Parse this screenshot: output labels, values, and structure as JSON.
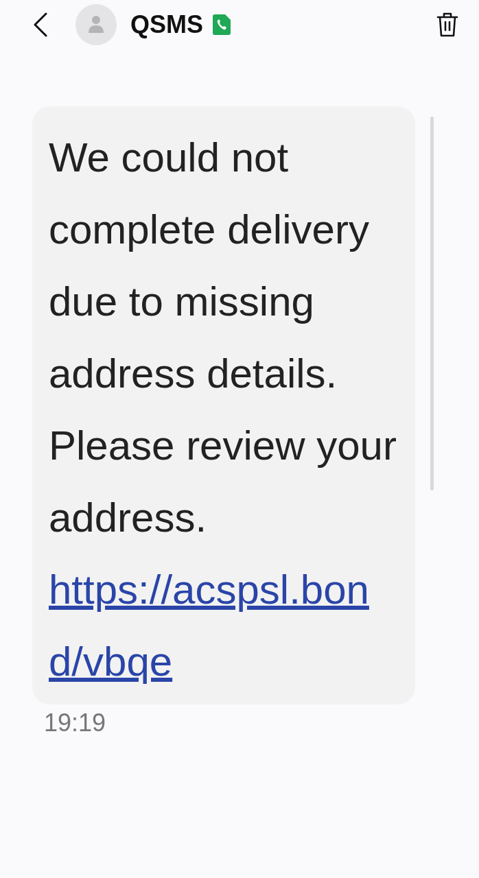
{
  "header": {
    "title": "QSMS"
  },
  "message": {
    "text": "We could not complete delivery due to missing address details. Please review your address.",
    "link": "https://acspsl.bond/vbqe",
    "time": "19:19"
  }
}
